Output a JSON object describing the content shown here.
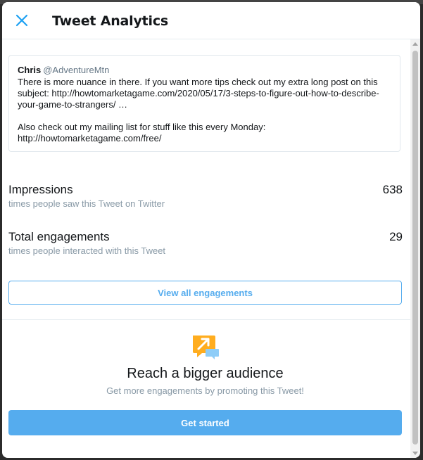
{
  "header": {
    "title": "Tweet Analytics"
  },
  "tweet": {
    "author_name": "Chris",
    "author_handle": "@AdventureMtn",
    "paragraphs": [
      "There is more nuance in there. If you want more tips check out my extra long post on this subject: http://howtomarketagame.com/2020/05/17/3-steps-to-figure-out-how-to-describe-your-game-to-strangers/ …",
      "Also check out my mailing list for stuff like this every Monday: http://howtomarketagame.com/free/"
    ]
  },
  "metrics": {
    "impressions": {
      "label": "Impressions",
      "description": "times people saw this Tweet on Twitter",
      "value": "638"
    },
    "engagements": {
      "label": "Total engagements",
      "description": "times people interacted with this Tweet",
      "value": "29"
    }
  },
  "view_all_label": "View all engagements",
  "promo": {
    "icon": "promote-tweet-icon",
    "title": "Reach a bigger audience",
    "subtitle": "Get more engagements by promoting this Tweet!",
    "button_label": "Get started"
  },
  "colors": {
    "accent": "#55acee",
    "text_primary": "#14171a",
    "text_secondary": "#8899a6",
    "promo_icon_orange": "#ffad1f"
  }
}
